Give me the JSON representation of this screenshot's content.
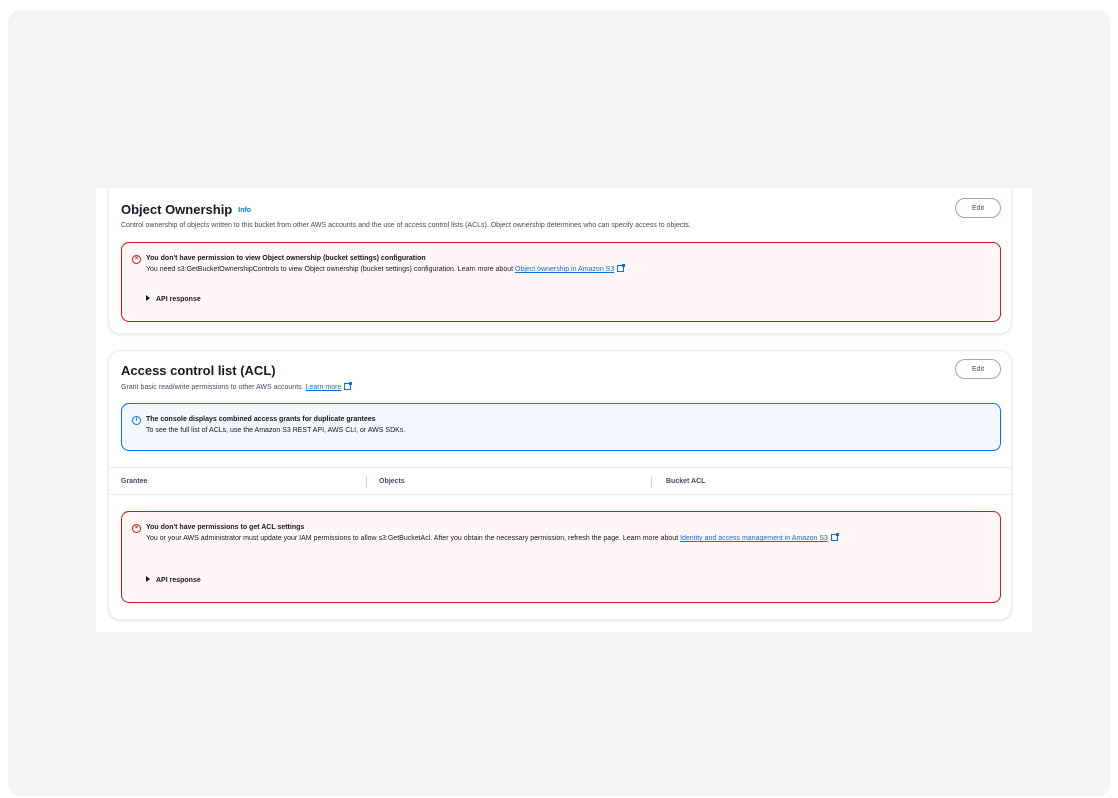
{
  "object_ownership": {
    "title": "Object Ownership",
    "info_label": "Info",
    "description": "Control ownership of objects written to this bucket from other AWS accounts and the use of access control lists (ACLs). Object ownership determines who can specify access to objects.",
    "edit_label": "Edit",
    "alert": {
      "heading": "You don't have permission to view Object ownership (bucket settings) configuration",
      "body_text": "You need s3:GetBucketOwnershipControls to view Object ownership (bucket settings) configuration. Learn more about ",
      "link_text": "Object ownership in Amazon S3",
      "expander_label": "API response"
    }
  },
  "acl": {
    "title": "Access control list (ACL)",
    "description": "Grant basic read/write permissions to other AWS accounts. ",
    "learn_more": "Learn more",
    "edit_label": "Edit",
    "info_alert": {
      "heading": "The console displays combined access grants for duplicate grantees",
      "body_text": "To see the full list of ACLs, use the Amazon S3 REST API, AWS CLI, or AWS SDKs."
    },
    "table": {
      "columns": [
        "Grantee",
        "Objects",
        "Bucket ACL"
      ]
    },
    "alert": {
      "heading": "You don't have permissions to get ACL settings",
      "body_text": "You or your AWS administrator must update your IAM permissions to allow s3:GetBucketAcl. After you obtain the necessary permission, refresh the page. Learn more about ",
      "link_text": "Identity and access management in Amazon S3",
      "expander_label": "API response"
    }
  },
  "icons": {
    "error": "error-circle-icon",
    "info": "info-circle-icon",
    "external": "external-link-icon",
    "caret": "caret-right-icon"
  },
  "colors": {
    "error": "#d91515",
    "info": "#0972d3",
    "link": "#0972d3"
  }
}
